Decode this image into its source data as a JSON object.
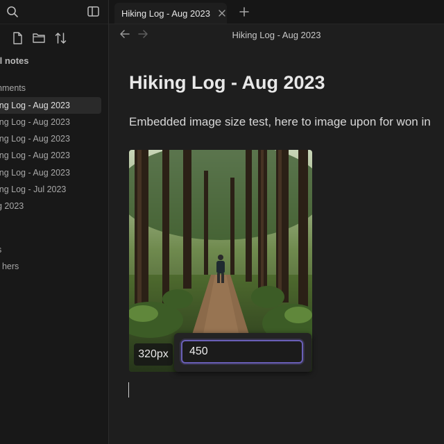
{
  "sidebar": {
    "folder_label": "ll notes",
    "section_label": "nments",
    "items": [
      {
        "label": "ing Log - Aug 2023",
        "active": true
      },
      {
        "label": "ing Log - Aug 2023",
        "active": false
      },
      {
        "label": "ing Log - Aug 2023",
        "active": false
      },
      {
        "label": "ing Log - Aug 2023",
        "active": false
      },
      {
        "label": "ing Log - Aug 2023",
        "active": false
      },
      {
        "label": "ing Log - Jul 2023",
        "active": false
      },
      {
        "label": "g 2023",
        "active": false
      }
    ],
    "extra_items": [
      {
        "label": "s"
      },
      {
        "label": "t hers"
      }
    ]
  },
  "tab": {
    "title": "Hiking Log - Aug 2023"
  },
  "navbar": {
    "title": "Hiking Log - Aug 2023"
  },
  "note": {
    "title": "Hiking Log - Aug 2023",
    "body": "Embedded image size test, here to image upon for won in"
  },
  "embed": {
    "size_label": "320px",
    "size_input_value": "450"
  },
  "icons": {
    "search": "search-icon",
    "sidebar_toggle": "sidebar-toggle-icon",
    "new_note": "new-note-icon",
    "new_folder": "new-folder-icon",
    "sort": "sort-icon",
    "close_tab": "close-icon",
    "new_tab": "plus-icon",
    "back": "arrow-left-icon",
    "forward": "arrow-right-icon"
  },
  "colors": {
    "accent": "#6a5fb8",
    "background": "#1e1e1e",
    "sidebar": "#181818"
  }
}
